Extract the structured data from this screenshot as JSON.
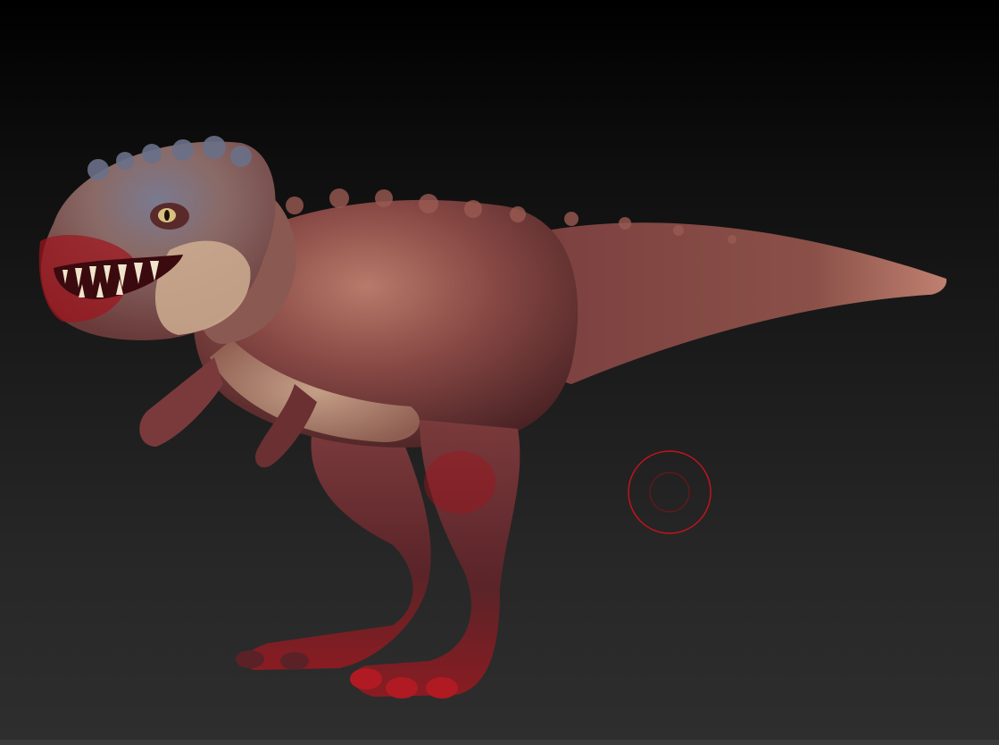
{
  "canvas": {
    "background_top": "#000000",
    "background_bottom": "#2e2e2e"
  },
  "model": {
    "subject": "t-rex-sculpt",
    "skin_color": "#8a4a46",
    "belly_color": "#c9a58a",
    "head_top_color": "#5a6378",
    "blood_color": "#a0141c"
  },
  "brush_cursor": {
    "outer_color": "#c0141c",
    "inner_color": "#7a1418"
  }
}
